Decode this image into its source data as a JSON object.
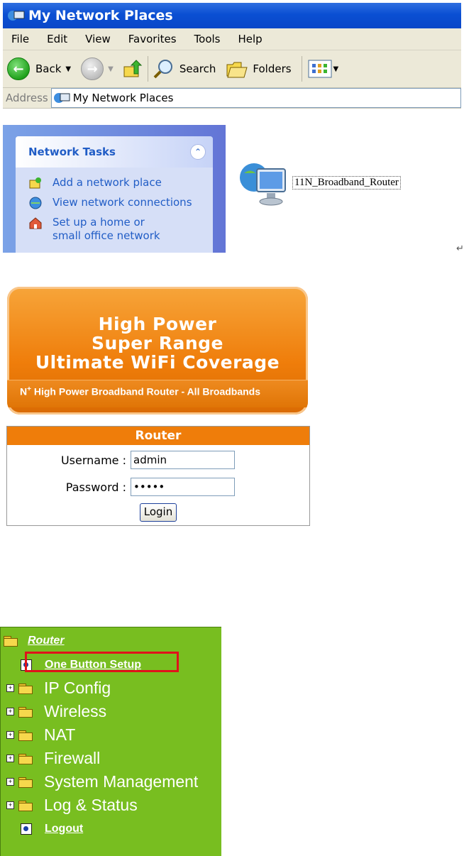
{
  "explorer": {
    "title": "My Network Places",
    "menu": [
      "File",
      "Edit",
      "View",
      "Favorites",
      "Tools",
      "Help"
    ],
    "toolbar": {
      "back": "Back",
      "search": "Search",
      "folders": "Folders"
    },
    "address": {
      "label": "Address",
      "value": "My Network Places"
    },
    "tasks": {
      "header": "Network Tasks",
      "items": [
        {
          "label": "Add a network place",
          "icon": "add-network-place-icon"
        },
        {
          "label": "View network connections",
          "icon": "network-connections-icon"
        },
        {
          "label": "Set up a home or small office network",
          "icon": "home-network-icon"
        }
      ]
    },
    "item": {
      "label": "11N_Broadband_Router",
      "icon": "network-computer-icon"
    }
  },
  "banner": {
    "line1": "High Power",
    "line2": "Super Range",
    "line3": "Ultimate WiFi Coverage",
    "tag_prefix": "N",
    "tag_sup": "+",
    "tag_text": "High Power Broadband Router - All Broadbands"
  },
  "login": {
    "header": "Router",
    "username_label": "Username :",
    "username_value": "admin",
    "password_label": "Password :",
    "password_value": "•••••",
    "button": "Login"
  },
  "menu": {
    "root": "Router",
    "one_button": "One Button Setup",
    "folders": [
      "IP Config",
      "Wireless",
      "NAT",
      "Firewall",
      "System Management",
      "Log & Status"
    ],
    "logout": "Logout"
  },
  "colors": {
    "xp_blue": "#0a4fd3",
    "banner_orange": "#ef7d0a",
    "menu_green": "#78be20",
    "highlight_red": "#e0121b"
  }
}
